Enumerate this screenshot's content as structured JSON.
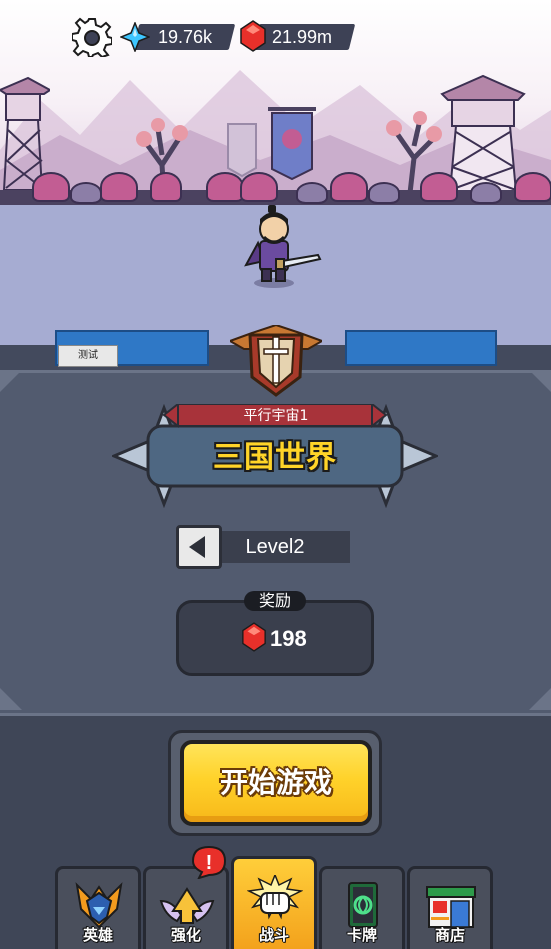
{
  "currencies": {
    "diamonds": "19.76k",
    "rubies": "21.99m"
  },
  "test_tag": "测试",
  "world": {
    "universe_label": "平行宇宙1",
    "name": "三国世界"
  },
  "level": {
    "label": "Level2"
  },
  "reward": {
    "title": "奖励",
    "value": "198"
  },
  "start_button": "开始游戏",
  "nav": {
    "tabs": [
      {
        "label": "英雄",
        "icon": "hero-helmet-icon"
      },
      {
        "label": "强化",
        "icon": "winged-upgrade-icon"
      },
      {
        "label": "战斗",
        "icon": "battle-fist-icon",
        "active": true
      },
      {
        "label": "卡牌",
        "icon": "card-icon"
      },
      {
        "label": "商店",
        "icon": "shop-icon"
      }
    ],
    "alert_badge": "!"
  },
  "colors": {
    "accent_yellow": "#ffd22a",
    "panel": "#525b6f",
    "ruby": "#e8302a",
    "diamond": "#3ec6ff"
  }
}
